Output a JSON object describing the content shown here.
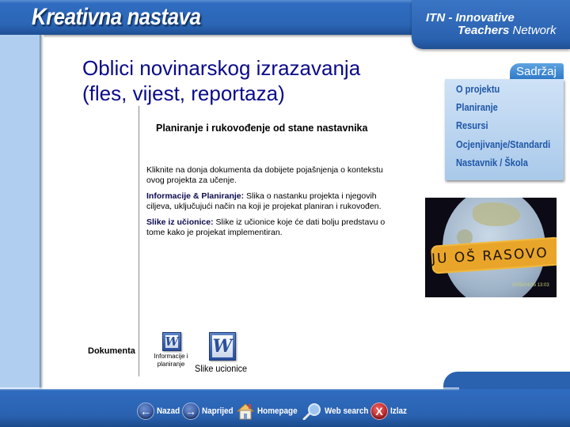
{
  "header": {
    "app_title": "Kreativna nastava",
    "brand_line1": "ITN - Innovative",
    "brand_line2_bold": "Teachers",
    "brand_line2_rest": " Network"
  },
  "main": {
    "title_line1": "Oblici novinarskog izrazavanja",
    "title_line2": "(fles, vijest, reportaza)",
    "subheading": "Planiranje i rukovođenje od stane nastavnika",
    "intro": "Kliknite na donja dokumenta da dobijete pojašnjenja o kontekstu ovog projekta za učenje.",
    "paragraphs": [
      {
        "term": "Informacije & Planiranje:",
        "text": " Slika o nastanku projekta i njegovih ciljeva, uključujući način na koji je projekat planiran i rukovođen."
      },
      {
        "term": "Slike iz učionice:",
        "text": " Slike iz učionice koje će dati bolju predstavu o tome kako je projekat implementiran."
      }
    ],
    "documents_label": "Dokumenta",
    "documents": [
      {
        "label": "Informacije i planiranje",
        "icon": "word-document-icon"
      },
      {
        "label": "Slike ucionice",
        "icon": "word-document-icon"
      }
    ]
  },
  "sidebar": {
    "tab_label": "Sadržaj",
    "items": [
      {
        "label": "O  projektu"
      },
      {
        "label": "Planiranje"
      },
      {
        "label": "Resursi"
      },
      {
        "label": "Ocjenjivanje/Standardi"
      },
      {
        "label": "Nastavnik / Škola"
      }
    ]
  },
  "photo": {
    "banner_text": "JU OŠ RASOVO",
    "timestamp": "2005/04/15 13:03"
  },
  "footer": {
    "buttons": [
      {
        "label": "Nazad",
        "icon": "arrow-left-icon"
      },
      {
        "label": "Naprijed",
        "icon": "arrow-right-icon"
      },
      {
        "label": "Homepage",
        "icon": "home-icon"
      },
      {
        "label": "Web search",
        "icon": "magnifier-icon"
      },
      {
        "label": "Izlaz",
        "icon": "exit-icon"
      }
    ]
  },
  "colors": {
    "brand_blue": "#2b66b6",
    "title_navy": "#0a0a8a",
    "nav_text": "#1e56a8",
    "stripe": "#b0cff0"
  }
}
